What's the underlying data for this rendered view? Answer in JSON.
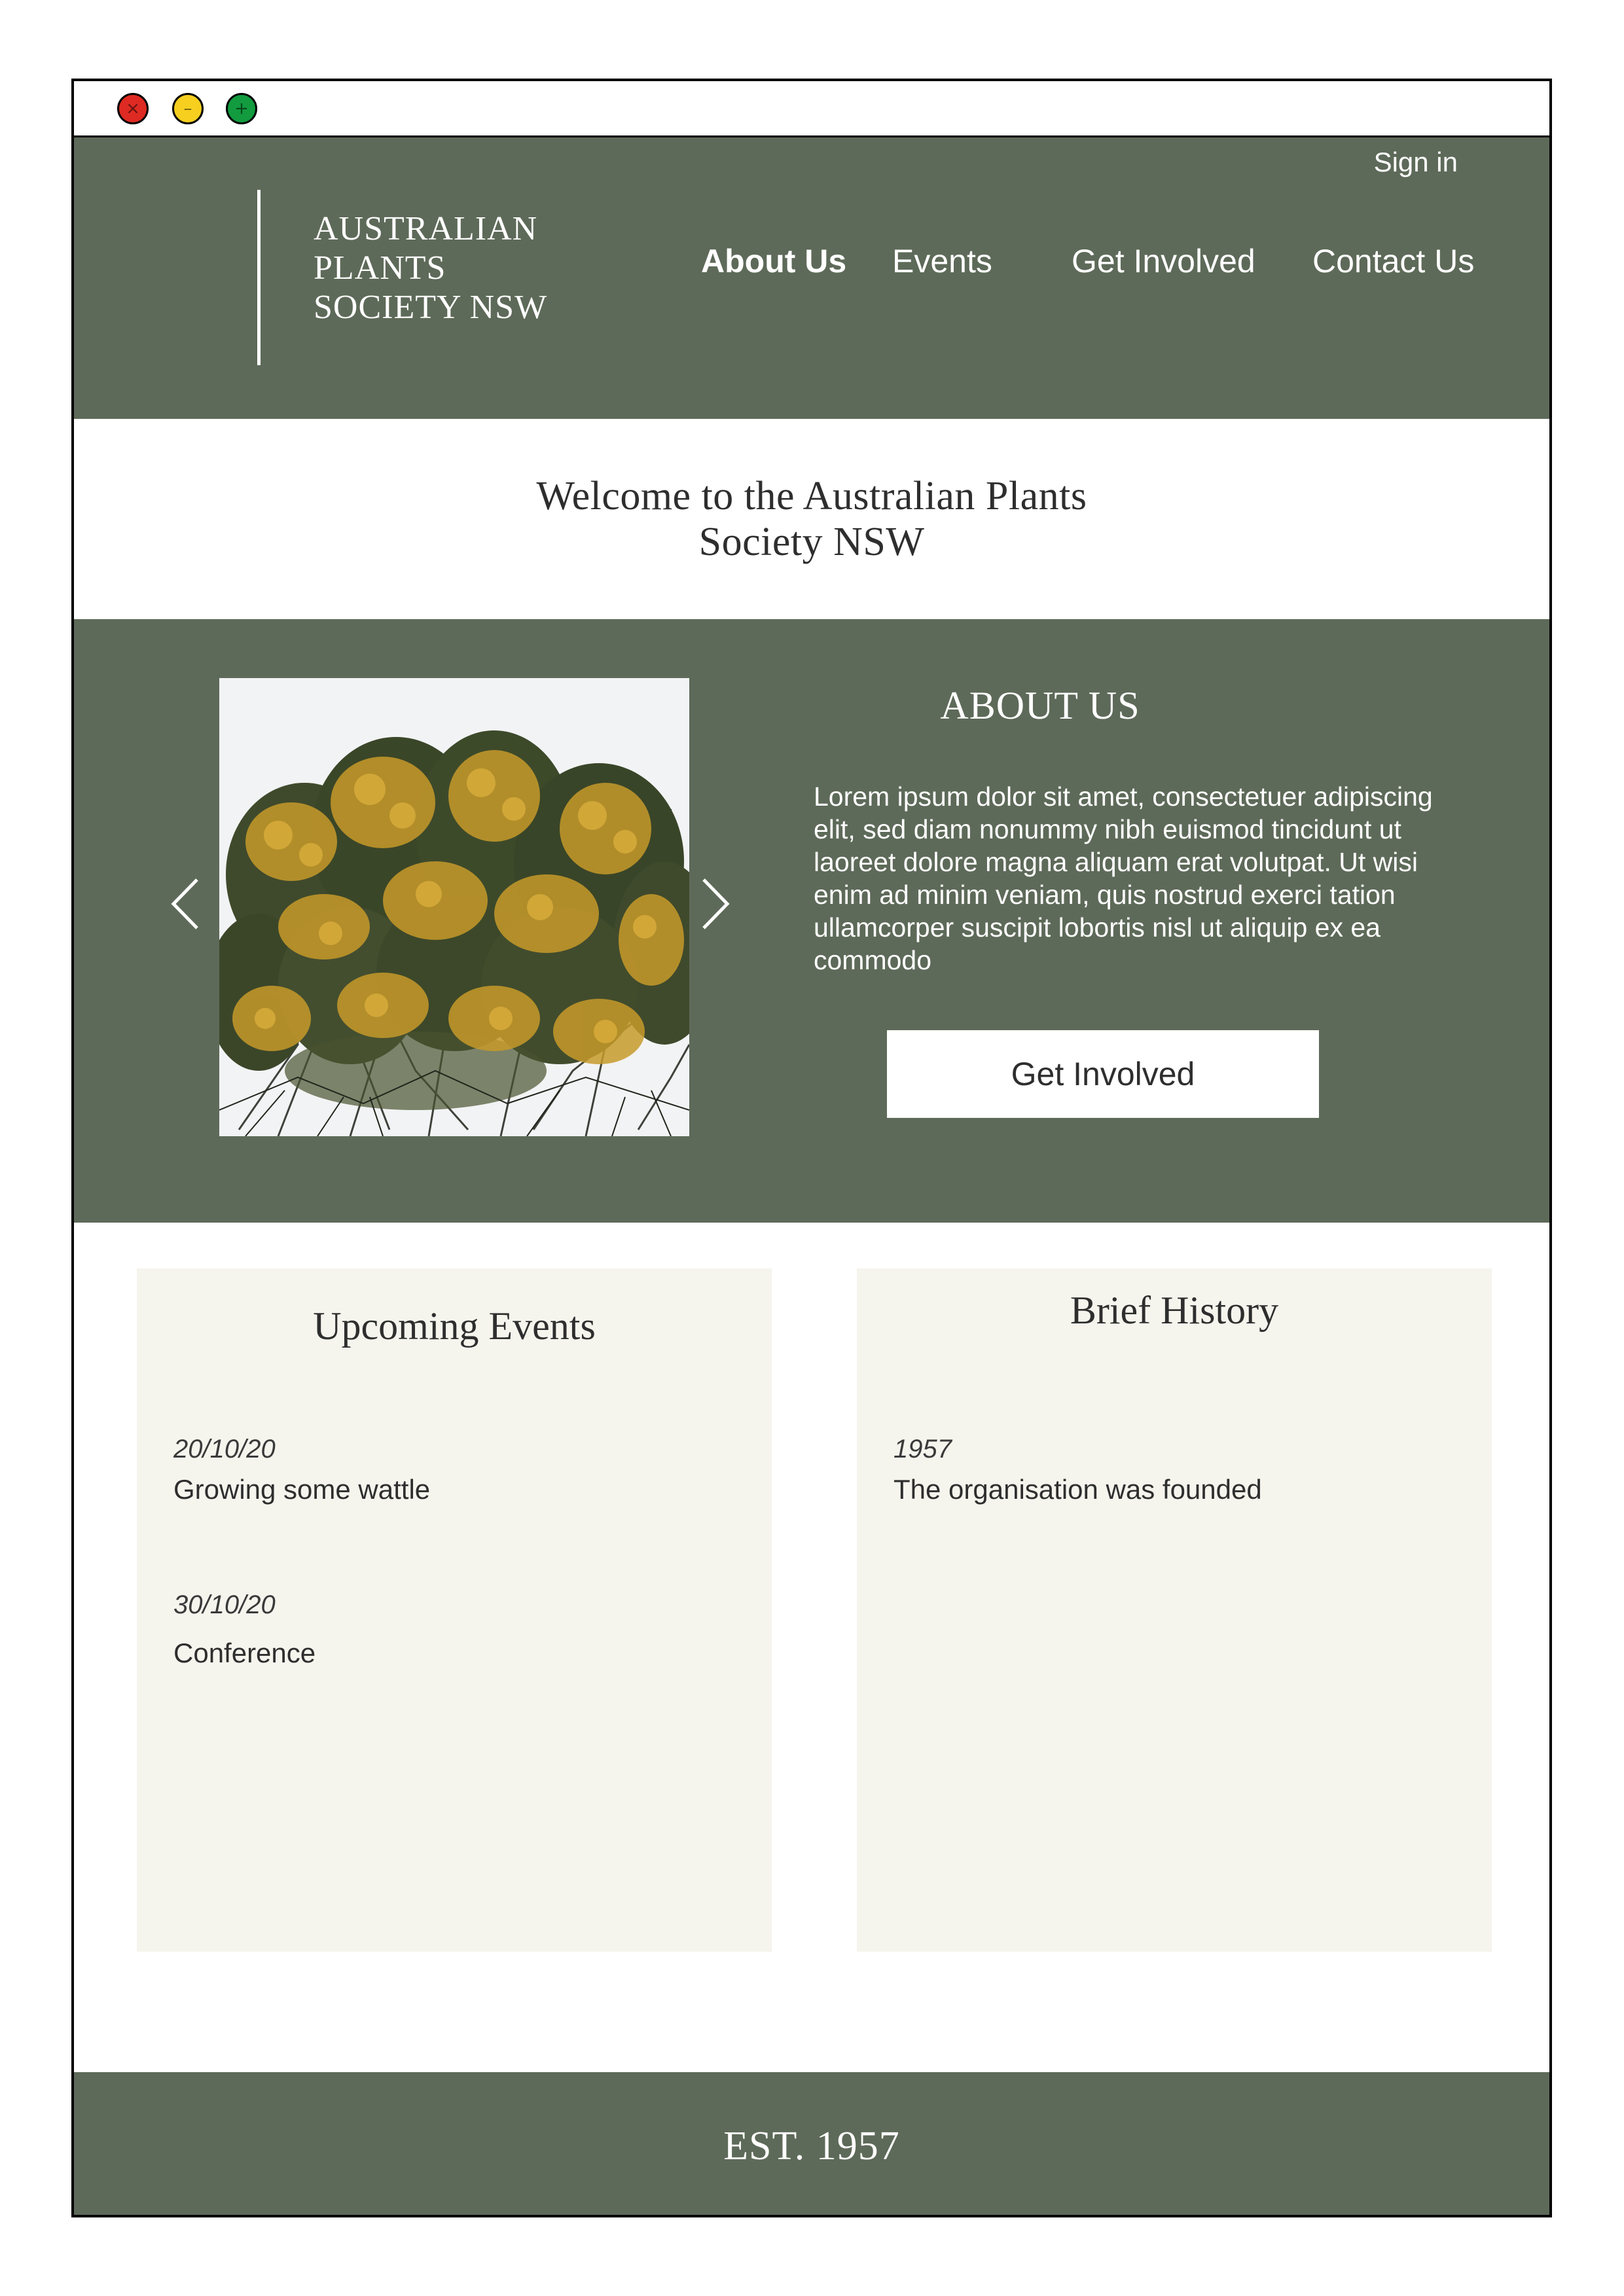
{
  "window": {
    "controls": [
      "close",
      "minimize",
      "maximize"
    ],
    "colors": {
      "close": "#de2a22",
      "minimize": "#f6cf1f",
      "maximize": "#129b3f"
    }
  },
  "header": {
    "sign_in": "Sign in",
    "logo_lines": [
      "AUSTRALIAN",
      "PLANTS",
      "SOCIETY NSW"
    ],
    "nav": [
      {
        "label": "About Us",
        "active": true
      },
      {
        "label": "Events",
        "active": false
      },
      {
        "label": "Get Involved",
        "active": false
      },
      {
        "label": "Contact Us",
        "active": false
      }
    ]
  },
  "welcome": {
    "heading": "Welcome to the Australian Plants Society NSW"
  },
  "about": {
    "title": "ABOUT US",
    "image_icon": "wattle-tree-photo",
    "prev_icon": "chevron-left-icon",
    "next_icon": "chevron-right-icon",
    "body": "Lorem ipsum dolor sit amet, consectetuer adipiscing elit, sed diam nonummy nibh euismod tincidunt ut laoreet dolore magna aliquam erat volutpat. Ut wisi enim ad minim veniam, quis nostrud exerci tation ullamcorper suscipit lobortis nisl ut aliquip ex ea commodo",
    "cta": "Get Involved"
  },
  "events": {
    "title": "Upcoming Events",
    "items": [
      {
        "date": "20/10/20",
        "name": "Growing some wattle"
      },
      {
        "date": "30/10/20",
        "name": "Conference"
      }
    ]
  },
  "history": {
    "title": "Brief History",
    "items": [
      {
        "year": "1957",
        "text": "The organisation was founded"
      }
    ]
  },
  "footer": {
    "text": "EST. 1957"
  },
  "colors": {
    "brand_green": "#5e6a59",
    "panel_bg": "#f5f5ee",
    "text_dark": "#2e2e2e"
  }
}
